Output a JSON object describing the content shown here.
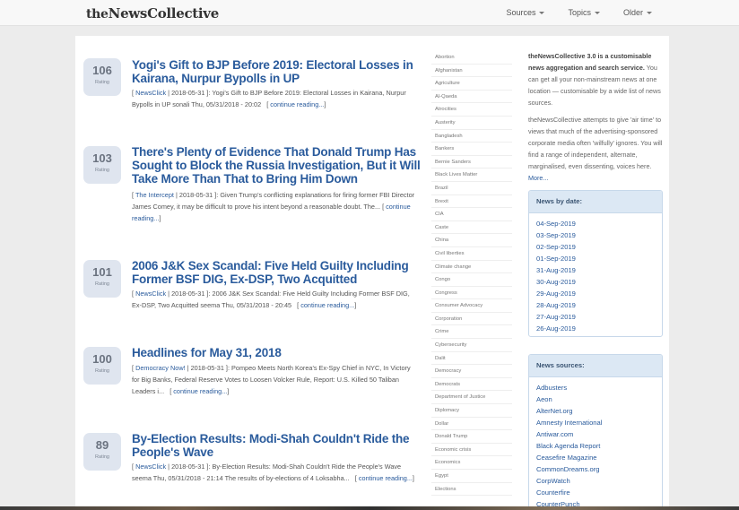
{
  "navbar": {
    "logo_prefix": "the",
    "logo_main": "NewsCollective",
    "menu": [
      {
        "label": "Sources"
      },
      {
        "label": "Topics"
      },
      {
        "label": "Older"
      }
    ]
  },
  "articles": [
    {
      "rating": "106",
      "rating_label": "Rating",
      "title": "Yogi's Gift to BJP Before 2019: Electoral Losses in Kairana, Nurpur Bypolls in UP",
      "source": "NewsClick",
      "date": "2018-05-31",
      "snippet": "Yogi's Gift to BJP Before 2019: Electoral Losses in Kairana, Nurpur Bypolls in UP sonali Thu, 05/31/2018 - 20:02",
      "more": "continue reading..."
    },
    {
      "rating": "103",
      "rating_label": "Rating",
      "title": "There's Plenty of Evidence That Donald Trump Has Sought to Block the Russia Investigation, But it Will Take More Than That to Bring Him Down",
      "source": "The Intercept",
      "date": "2018-05-31",
      "snippet": "Given Trump's conflicting explanations for firing former FBI Director James Comey, it may be difficult to prove his intent beyond a reasonable doubt. The...",
      "more": "continue reading..."
    },
    {
      "rating": "101",
      "rating_label": "Rating",
      "title": "2006 J&K Sex Scandal: Five Held Guilty Including Former BSF DIG,  Ex-DSP, Two Acquitted",
      "source": "NewsClick",
      "date": "2018-05-31",
      "snippet": "2006 J&K Sex Scandal: Five Held Guilty Including Former BSF DIG, Ex-DSP, Two Acquitted seema Thu, 05/31/2018 - 20:45",
      "more": "continue reading..."
    },
    {
      "rating": "100",
      "rating_label": "Rating",
      "title": "Headlines for May 31, 2018",
      "source": "Democracy Now!",
      "date": "2018-05-31",
      "snippet": "Pompeo Meets North Korea's Ex-Spy Chief in NYC, In Victory for Big Banks, Federal Reserve Votes to Loosen Volcker Rule, Report: U.S. Killed 50 Taliban Leaders i...",
      "more": "continue reading..."
    },
    {
      "rating": "89",
      "rating_label": "Rating",
      "title": "By-Election Results: Modi-Shah Couldn't Ride the People's Wave",
      "source": "NewsClick",
      "date": "2018-05-31",
      "snippet": "By-Election Results: Modi-Shah Couldn't Ride the People's Wave seema Thu, 05/31/2018 - 21:14 The results of by-elections of 4 Loksabha...",
      "more": "continue reading..."
    }
  ],
  "tags": [
    "Abortion",
    "Afghanistan",
    "Agriculture",
    "Al-Qaeda",
    "Atrocities",
    "Austerity",
    "Bangladesh",
    "Bankers",
    "Bernie Sanders",
    "Black Lives Matter",
    "Brazil",
    "Brexit",
    "CIA",
    "Caste",
    "China",
    "Civil liberties",
    "Climate change",
    "Congo",
    "Congress",
    "Consumer Advocacy",
    "Corporation",
    "Crime",
    "Cybersecurity",
    "Dalit",
    "Democracy",
    "Democrats",
    "Department of Justice",
    "Diplomacy",
    "Dollar",
    "Donald Trump",
    "Economic crisis",
    "Economics",
    "Egypt",
    "Elections"
  ],
  "about": {
    "heading": "theNewsCollective 3.0 is a customisable news aggregation and search service.",
    "para1": "You can get all your non-mainstream news at one location — customisable by a wide list of news sources.",
    "para2": "theNewsCollective attempts to give 'air time' to views that much of the advertising-sponsored corporate media often 'wilfully' ignores. You will find a range of independent, alternate, marginalised, even dissenting, voices here.",
    "more": "More..."
  },
  "news_by_date": {
    "title": "News by date:",
    "dates": [
      "04-Sep-2019",
      "03-Sep-2019",
      "02-Sep-2019",
      "01-Sep-2019",
      "31-Aug-2019",
      "30-Aug-2019",
      "29-Aug-2019",
      "28-Aug-2019",
      "27-Aug-2019",
      "26-Aug-2019"
    ]
  },
  "news_sources": {
    "title": "News sources:",
    "sources": [
      "Adbusters",
      "Aeon",
      "AlterNet.org",
      "Amnesty International",
      "Antiwar.com",
      "Black Agenda Report",
      "Ceasefire Magazine",
      "CommonDreams.org",
      "CorpWatch",
      "Counterfire",
      "CounterPunch"
    ]
  }
}
